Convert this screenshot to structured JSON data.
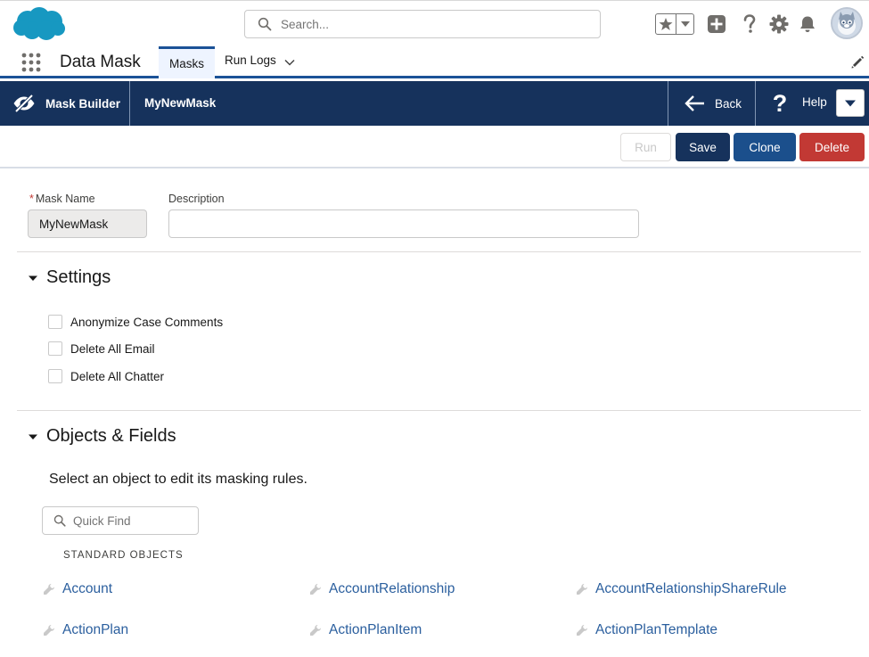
{
  "global_header": {
    "search_placeholder": "Search...",
    "icons": [
      "salesforce-cloud-logo",
      "search-icon",
      "star-icon",
      "chevron-down-icon",
      "plus-icon",
      "question-icon",
      "gear-icon",
      "bell-icon",
      "avatar"
    ]
  },
  "nav": {
    "app_name": "Data Mask",
    "tabs": [
      {
        "label": "Masks",
        "active": true
      },
      {
        "label": "Run Logs",
        "active": false
      }
    ]
  },
  "toolbar": {
    "mask_builder_label": "Mask Builder",
    "mask_title": "MyNewMask",
    "back_label": "Back",
    "help_label": "Help"
  },
  "actions": {
    "run": "Run",
    "save": "Save",
    "clone": "Clone",
    "delete": "Delete"
  },
  "form": {
    "mask_name_label": "Mask Name",
    "mask_name_value": "MyNewMask",
    "description_label": "Description",
    "description_value": ""
  },
  "settings": {
    "title": "Settings",
    "options": [
      {
        "label": "Anonymize Case Comments",
        "checked": false
      },
      {
        "label": "Delete All Email",
        "checked": false
      },
      {
        "label": "Delete All Chatter",
        "checked": false
      }
    ]
  },
  "objects": {
    "title": "Objects & Fields",
    "help_text": "Select an object to edit its masking rules.",
    "quick_find_placeholder": "Quick Find",
    "standard_label": "STANDARD OBJECTS",
    "items": [
      "Account",
      "AccountRelationship",
      "AccountRelationshipShareRule",
      "ActionPlan",
      "ActionPlanItem",
      "ActionPlanTemplate"
    ]
  },
  "colors": {
    "brand_dark": "#16325c",
    "nav_accent": "#1b5297",
    "link": "#2b5f9e",
    "delete": "#c23934",
    "logo_blue": "#1798c1"
  }
}
